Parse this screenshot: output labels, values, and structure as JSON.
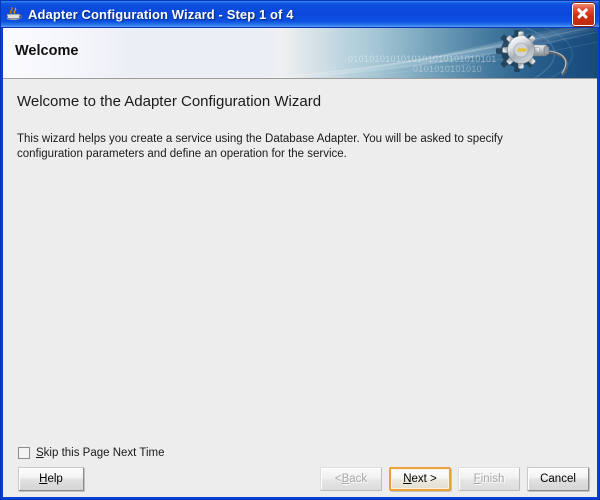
{
  "window": {
    "title": "Adapter Configuration Wizard - Step 1 of 4",
    "icon": "coffee-cup-icon",
    "close_label": "Close",
    "title_bar_color": "#0b47db",
    "frame_color": "#0a3fd4"
  },
  "banner": {
    "title": "Welcome",
    "binary_row_1": "0101010101010101010101010101",
    "binary_row_2": "0101010101010",
    "graphic": "gear-cable-icon",
    "gradient_from": "#fbfbfe",
    "gradient_to": "#184a7b"
  },
  "page": {
    "heading": "Welcome to the Adapter Configuration Wizard",
    "paragraph": "This wizard helps you create a service using the Database Adapter. You will be asked to specify configuration parameters and define an operation for the service."
  },
  "options": {
    "skip_page": {
      "label_before": "S",
      "label_after": "kip this Page Next Time",
      "checked": false
    }
  },
  "buttons": {
    "help": {
      "before": "H",
      "mnemonic": "",
      "after": "elp",
      "enabled": true,
      "focused": false
    },
    "back": {
      "before": "< ",
      "mnemonic": "B",
      "after": "ack",
      "enabled": false,
      "focused": false
    },
    "next": {
      "before": "",
      "mnemonic": "N",
      "after": "ext >",
      "enabled": true,
      "focused": true
    },
    "finish": {
      "before": "",
      "mnemonic": "F",
      "after": "inish",
      "enabled": false,
      "focused": false
    },
    "cancel": {
      "before": "",
      "mnemonic": "",
      "after": "Cancel",
      "enabled": true,
      "focused": false
    }
  },
  "colors": {
    "content_bg": "#ededed",
    "focus_border": "#e9a33a",
    "disabled_text": "#a6a6a6"
  }
}
